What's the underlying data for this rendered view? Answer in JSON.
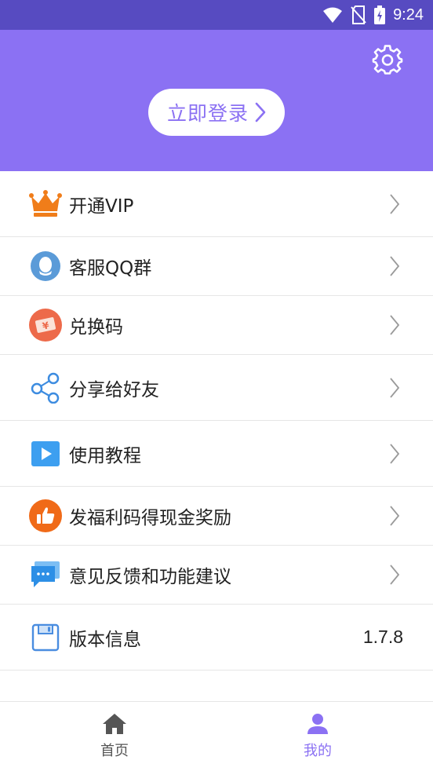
{
  "status_bar": {
    "time": "9:24"
  },
  "header": {
    "login_label": "立即登录"
  },
  "menu": {
    "items": [
      {
        "label": "开通VIP",
        "icon": "crown-icon"
      },
      {
        "label": "客服QQ群",
        "icon": "qq-penguin-icon"
      },
      {
        "label": "兑换码",
        "icon": "ticket-icon"
      },
      {
        "label": "分享给好友",
        "icon": "share-icon"
      },
      {
        "label": "使用教程",
        "icon": "play-icon"
      },
      {
        "label": "发福利码得现金奖励",
        "icon": "thumbs-up-icon"
      },
      {
        "label": "意见反馈和功能建议",
        "icon": "chat-bubble-icon"
      }
    ],
    "version": {
      "label": "版本信息",
      "value": "1.7.8",
      "icon": "floppy-disk-icon"
    }
  },
  "bottom_nav": {
    "home_label": "首页",
    "mine_label": "我的"
  },
  "colors": {
    "accent": "#8b71f3",
    "status_bar": "#574bc1",
    "crown": "#f07d1a",
    "qq": "#5b9bd8",
    "ticket": "#ed6a4a",
    "share": "#3d8ce0",
    "play": "#3d9ff0",
    "thumbs": "#f06a18",
    "chat": "#2d8fe6",
    "floppy": "#4a8de0",
    "nav_inactive": "#555555"
  }
}
